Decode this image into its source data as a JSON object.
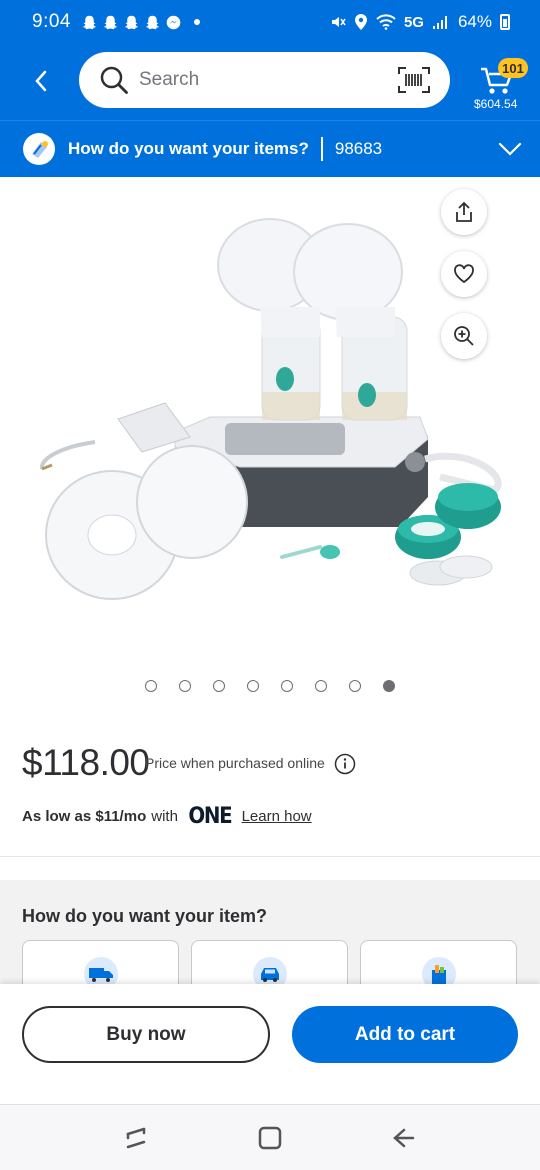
{
  "status_bar": {
    "time": "9:04",
    "network": "5G",
    "battery": "64%"
  },
  "header": {
    "search_placeholder": "Search",
    "cart_count": "101",
    "cart_total": "$604.54"
  },
  "fulfillment_bar": {
    "question": "How do you want your items?",
    "zip": "98683"
  },
  "gallery": {
    "image_count": 8,
    "active_index": 7
  },
  "product": {
    "price": "$118.00",
    "price_note": "Price when purchased online",
    "as_low_as": "As low as $11/mo",
    "with": "with",
    "one_logo": "ONE",
    "learn_how": "Learn how"
  },
  "fulfillment_section": {
    "title": "How do you want your item?"
  },
  "actions": {
    "buy_now": "Buy now",
    "add_to_cart": "Add to cart"
  },
  "colors": {
    "brand_blue": "#0071dc",
    "badge_yellow": "#ffc220"
  }
}
